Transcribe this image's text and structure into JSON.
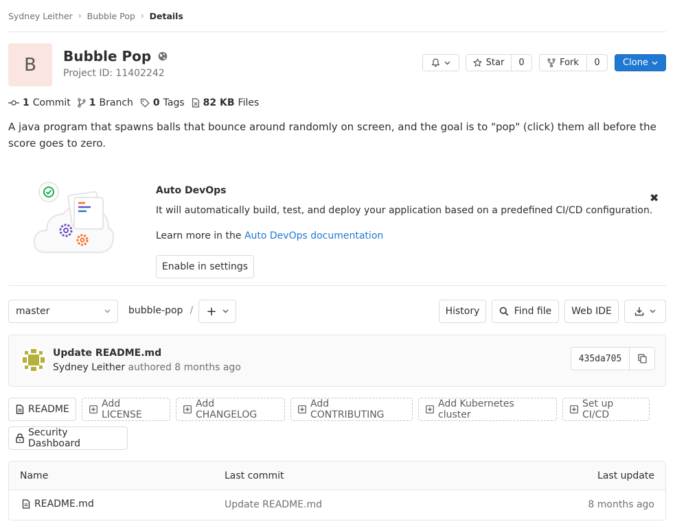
{
  "breadcrumb": {
    "items": [
      "Sydney Leither",
      "Bubble Pop"
    ],
    "current": "Details"
  },
  "project": {
    "avatar_letter": "B",
    "title": "Bubble Pop",
    "id_text": "Project ID: 11402242",
    "description": "A java program that spawns balls that bounce around randomly on screen, and the goal is to \"pop\" (click) them all before the score goes to zero."
  },
  "actions": {
    "star_label": "Star",
    "star_count": "0",
    "fork_label": "Fork",
    "fork_count": "0",
    "clone_label": "Clone"
  },
  "stats": {
    "commits_count": "1",
    "commits_label": "Commit",
    "branches_count": "1",
    "branches_label": "Branch",
    "tags_count": "0",
    "tags_label": "Tags",
    "files_size": "82 KB",
    "files_label": "Files"
  },
  "auto_devops": {
    "title": "Auto DevOps",
    "text": "It will automatically build, test, and deploy your application based on a predefined CI/CD configuration.",
    "learn_prefix": "Learn more in the ",
    "learn_link": "Auto DevOps documentation",
    "enable_label": "Enable in settings",
    "close_glyph": "✖"
  },
  "tree": {
    "branch": "master",
    "path": "bubble-pop",
    "slash": "/",
    "plus": "+",
    "history_label": "History",
    "find_file_label": "Find file",
    "web_ide_label": "Web IDE"
  },
  "last_commit": {
    "title": "Update README.md",
    "author": "Sydney Leither",
    "meta": " authored 8 months ago",
    "sha": "435da705"
  },
  "shortcuts": {
    "readme": "README",
    "add_license": "Add LICENSE",
    "add_changelog": "Add CHANGELOG",
    "add_contributing": "Add CONTRIBUTING",
    "add_kubernetes": "Add Kubernetes cluster",
    "setup_cicd": "Set up CI/CD",
    "security_dashboard": "Security Dashboard"
  },
  "files": {
    "headers": {
      "name": "Name",
      "last_commit": "Last commit",
      "last_update": "Last update"
    },
    "rows": [
      {
        "name": "README.md",
        "last_commit": "Update README.md",
        "last_update": "8 months ago"
      }
    ]
  },
  "colors": {
    "primary": "#1f78d1",
    "avatar_bg": "#fbe5e1",
    "link": "#1f78d1"
  }
}
